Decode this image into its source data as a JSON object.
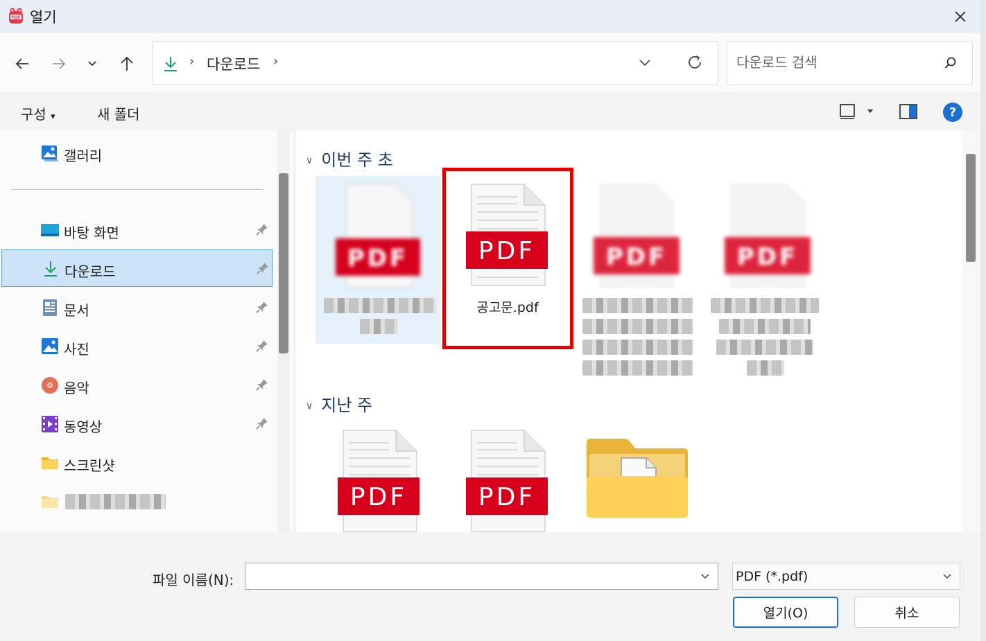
{
  "window": {
    "title": "열기",
    "app_icon": "pdf-app-icon"
  },
  "nav": {
    "back": "arrow-left-icon",
    "forward": "arrow-right-icon",
    "recent": "chevron-down-icon",
    "up": "arrow-up-icon"
  },
  "address": {
    "breadcrumb": [
      "다운로드"
    ],
    "separator": "›"
  },
  "search": {
    "placeholder": "다운로드 검색"
  },
  "commands": {
    "organize": "구성",
    "organize_caret": "▾",
    "new_folder": "새 폴더",
    "help": "?"
  },
  "sidebar": {
    "items": [
      {
        "label": "갤러리",
        "icon": "gallery-icon",
        "pinned": false
      },
      {
        "label": "바탕 화면",
        "icon": "desktop-icon",
        "pinned": true
      },
      {
        "label": "다운로드",
        "icon": "download-icon",
        "pinned": true,
        "selected": true
      },
      {
        "label": "문서",
        "icon": "documents-icon",
        "pinned": true
      },
      {
        "label": "사진",
        "icon": "pictures-icon",
        "pinned": true
      },
      {
        "label": "음악",
        "icon": "music-icon",
        "pinned": true
      },
      {
        "label": "동영상",
        "icon": "videos-icon",
        "pinned": true
      },
      {
        "label": "스크린샷",
        "icon": "folder-icon",
        "pinned": false
      },
      {
        "label": "",
        "icon": "folder-icon",
        "pinned": false,
        "blurred": true
      }
    ]
  },
  "groups": [
    {
      "label": "이번 주 초",
      "chevron": "∨"
    },
    {
      "label": "지난 주",
      "chevron": "∨"
    }
  ],
  "files": {
    "this_week": [
      {
        "name": "",
        "type": "pdf",
        "blurred": true,
        "selected": true
      },
      {
        "name": "공고문.pdf",
        "type": "pdf",
        "blurred": false,
        "highlighted": true
      },
      {
        "name": "",
        "type": "pdf",
        "blurred": true
      },
      {
        "name": "",
        "type": "pdf",
        "blurred": true
      }
    ],
    "last_week": [
      {
        "name": "",
        "type": "pdf"
      },
      {
        "name": "",
        "type": "pdf"
      },
      {
        "name": "",
        "type": "folder"
      }
    ],
    "pdf_badge": "PDF"
  },
  "bottom": {
    "filename_label": "파일 이름(N):",
    "filename_value": "",
    "filetype": "PDF (*.pdf)",
    "open_button": "열기(O)",
    "cancel_button": "취소"
  },
  "colors": {
    "accent": "#1b6fd1",
    "pdf_red": "#d6001c",
    "highlight": "#e00000",
    "selection": "#cde3f8"
  }
}
